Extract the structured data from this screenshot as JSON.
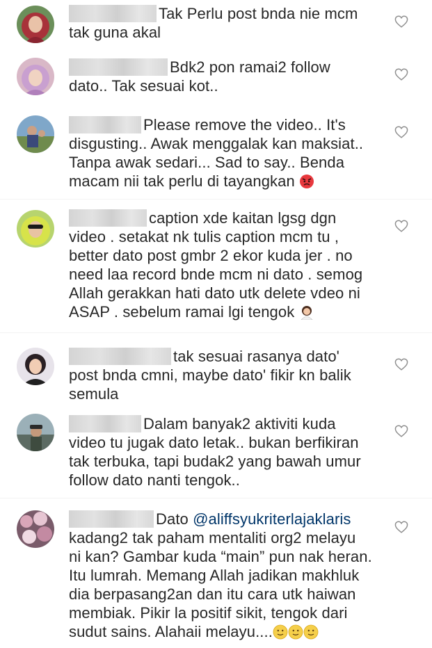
{
  "comments": [
    {
      "avatar": "avatar-hijab-red",
      "text_lines": [
        "Tak Perlu post bnda nie mcm",
        "tak guna akal"
      ]
    },
    {
      "avatar": "avatar-hijab-pink",
      "text_lines": [
        "Bdk2 pon ramai2 follow",
        "dato.. Tak sesuai kot.."
      ]
    },
    {
      "avatar": "avatar-outdoor",
      "text_lines": [
        "Please remove the video.. It's",
        "disgusting.. Awak menggalak kan maksiat..",
        "Tanpa awak sedari... Sad to say.. Benda",
        "macam nii tak perlu di tayangkan"
      ]
    },
    {
      "avatar": "avatar-hijab-yellow",
      "text_lines": [
        "caption xde kaitan lgsg dgn",
        "video . setakat nk tulis caption mcm tu ,",
        "better dato post gmbr 2 ekor kuda jer . no",
        "need laa record bnde mcm ni dato . semog",
        "Allah gerakkan hati dato utk delete vdeo ni",
        "ASAP . sebelum ramai lgi tengok"
      ]
    },
    {
      "avatar": "avatar-woman-dark",
      "text_lines": [
        "tak sesuai rasanya dato'",
        "post bnda cmni, maybe dato' fikir kn balik",
        "semula"
      ]
    },
    {
      "avatar": "avatar-man-cap",
      "text_lines": [
        "Dalam banyak2 aktiviti kuda",
        "video tu jugak dato letak.. bukan berfikiran",
        "tak terbuka, tapi budak2 yang bawah umur",
        "follow dato nanti tengok.."
      ]
    },
    {
      "avatar": "avatar-flowers",
      "first_prefix": "Dato ",
      "mention": "@aliffsyukriterlajaklaris",
      "text_lines": [
        "kadang2 tak paham mentaliti org2 melayu",
        "ni kan? Gambar kuda “main” pun nak heran.",
        "Itu lumrah. Memang Allah jadikan makhluk",
        "dia berpasang2an dan itu cara utk haiwan",
        "membiak. Pikir la positif sikit, tengok dari",
        "sudut sains. Alahaii melayu...."
      ]
    }
  ],
  "icons": {
    "like": "heart-outline-icon",
    "angry": "angry-face-emoji",
    "shrug": "woman-gesturing-emoji",
    "smile": "slight-smile-emoji"
  },
  "colors": {
    "text": "#262626",
    "mention": "#003569",
    "heart": "#8e8e8e"
  }
}
